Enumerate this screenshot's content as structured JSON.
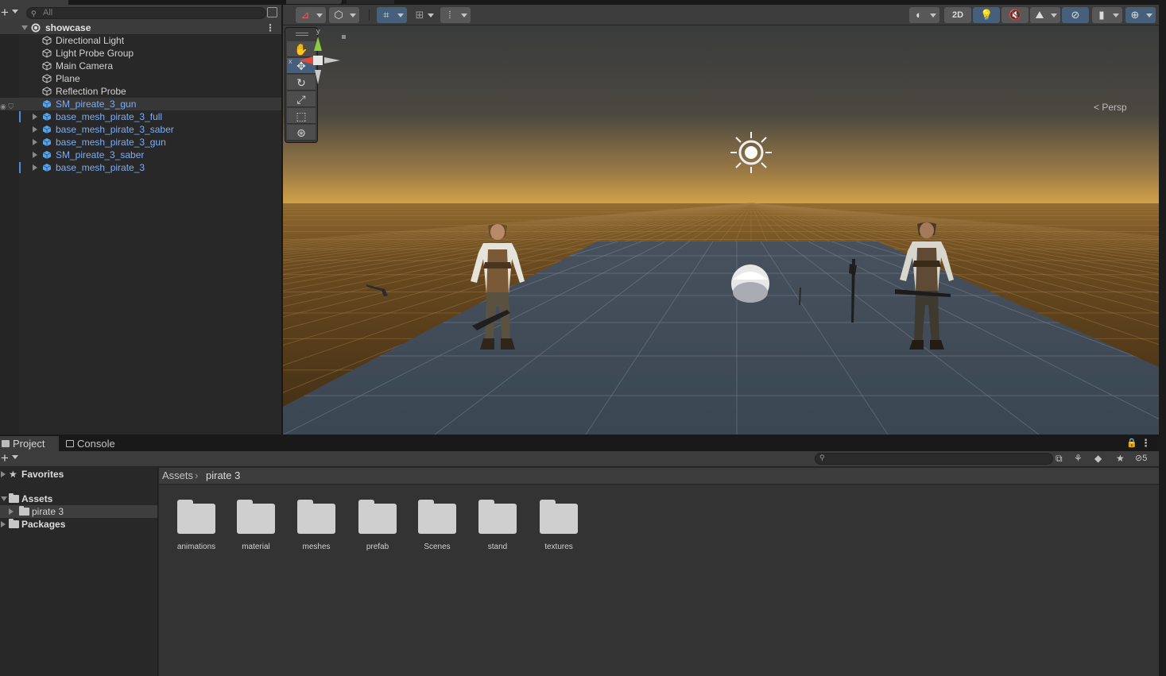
{
  "hierarchy": {
    "search_placeholder": "All",
    "scene_name": "showcase",
    "items": [
      {
        "label": "Directional Light",
        "type": "object"
      },
      {
        "label": "Light Probe Group",
        "type": "object"
      },
      {
        "label": "Main Camera",
        "type": "object"
      },
      {
        "label": "Plane",
        "type": "object"
      },
      {
        "label": "Reflection Probe",
        "type": "object"
      },
      {
        "label": "SM_pireate_3_gun",
        "type": "prefab"
      },
      {
        "label": "base_mesh_pirate_3_full",
        "type": "prefab"
      },
      {
        "label": "base_mesh_pirate_3_saber",
        "type": "prefab"
      },
      {
        "label": "base_mesh_pirate_3_gun",
        "type": "prefab"
      },
      {
        "label": "SM_pireate_3_saber",
        "type": "prefab"
      },
      {
        "label": "base_mesh_pirate_3",
        "type": "prefab"
      }
    ]
  },
  "scene": {
    "toolbar": {
      "two_d_label": "2D"
    },
    "projection_label": "Persp",
    "gizmo_axes": {
      "y": "y",
      "x": "x"
    },
    "tools": [
      "hand-icon",
      "move-icon",
      "rotate-icon",
      "scale-icon",
      "rect-icon",
      "transform-icon"
    ],
    "colors": {
      "sky_top": "#3c3d3d",
      "horizon": "#c89a44",
      "ground": "#4a3418",
      "plane": "#3e4a57",
      "selection_blue": "#46607c"
    }
  },
  "project": {
    "tabs": {
      "project": "Project",
      "console": "Console"
    },
    "hidden_count": "5",
    "tree": {
      "favorites": "Favorites",
      "assets": "Assets",
      "pirate": "pirate 3",
      "packages": "Packages"
    },
    "breadcrumb": {
      "root": "Assets",
      "current": "pirate 3"
    },
    "folders": [
      "animations",
      "material",
      "meshes",
      "prefab",
      "Scenes",
      "stand",
      "textures"
    ]
  }
}
